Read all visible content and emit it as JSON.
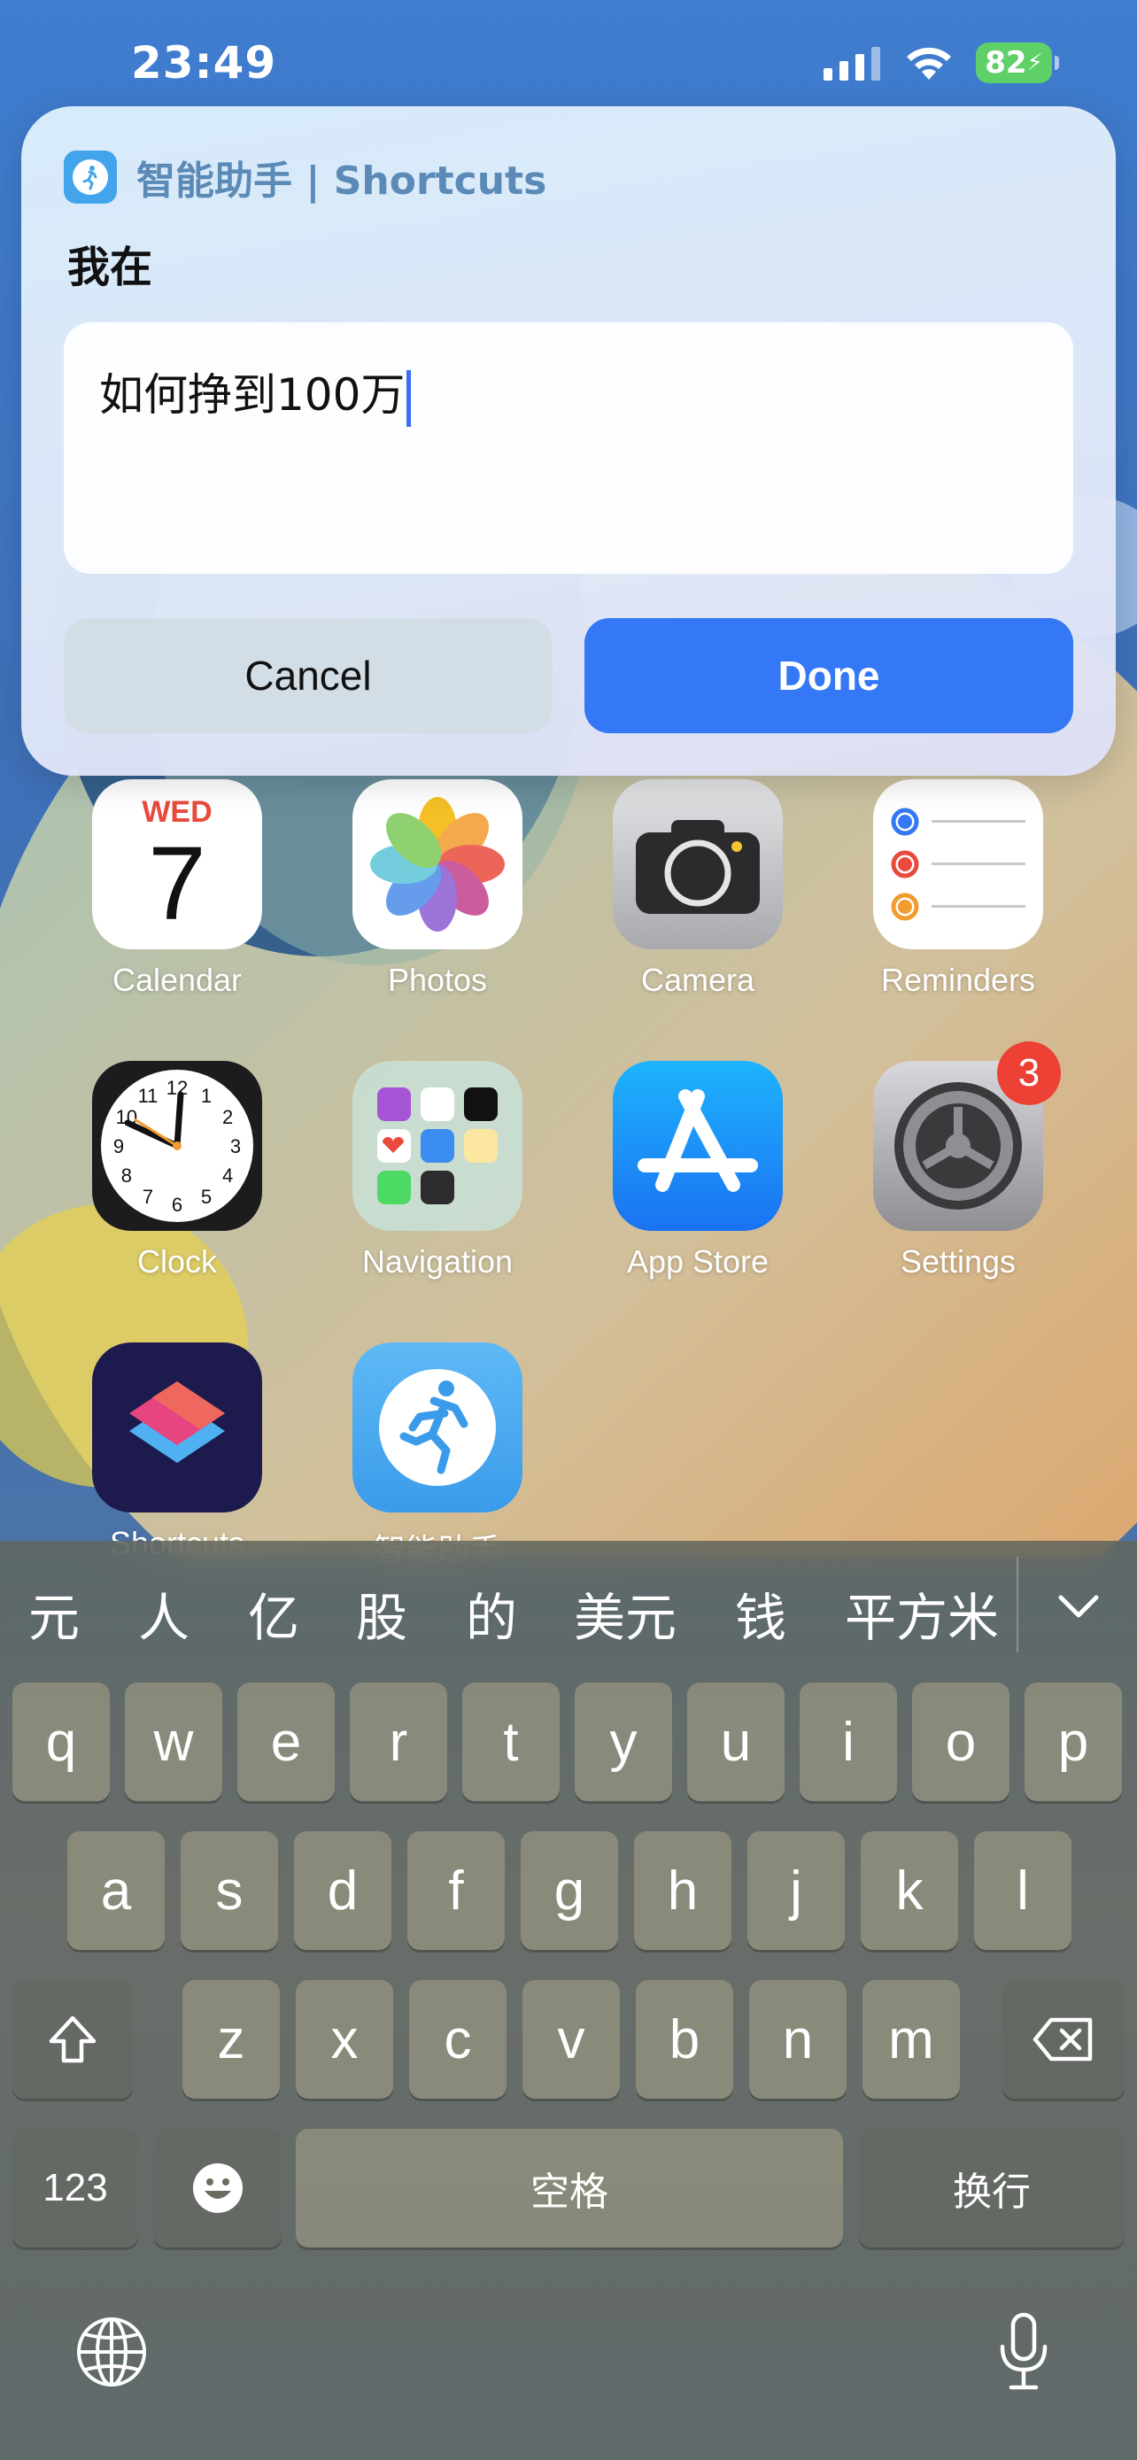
{
  "status_bar": {
    "time": "23:49",
    "battery": "82"
  },
  "dialog": {
    "app_name": "智能助手 | Shortcuts",
    "prompt": "我在",
    "input_value": "如何挣到100万",
    "cancel_label": "Cancel",
    "done_label": "Done"
  },
  "home_apps": [
    {
      "label": "Calendar",
      "icon": "calendar-icon",
      "day": "WED",
      "date": "7"
    },
    {
      "label": "Photos",
      "icon": "photos-icon"
    },
    {
      "label": "Camera",
      "icon": "camera-icon"
    },
    {
      "label": "Reminders",
      "icon": "reminders-icon"
    },
    {
      "label": "Clock",
      "icon": "clock-icon"
    },
    {
      "label": "Navigation",
      "icon": "folder-icon"
    },
    {
      "label": "App Store",
      "icon": "app-store-icon"
    },
    {
      "label": "Settings",
      "icon": "settings-icon",
      "badge": "3"
    },
    {
      "label": "Shortcuts",
      "icon": "shortcuts-icon"
    },
    {
      "label": "智能助手",
      "icon": "assistant-icon"
    }
  ],
  "clock_numbers": [
    "12",
    "1",
    "2",
    "3",
    "4",
    "5",
    "6",
    "7",
    "8",
    "9",
    "10",
    "11"
  ],
  "keyboard": {
    "candidates": [
      "元",
      "人",
      "亿",
      "股",
      "的",
      "美元",
      "钱",
      "平方米"
    ],
    "row1": [
      "q",
      "w",
      "e",
      "r",
      "t",
      "y",
      "u",
      "i",
      "o",
      "p"
    ],
    "row2": [
      "a",
      "s",
      "d",
      "f",
      "g",
      "h",
      "j",
      "k",
      "l"
    ],
    "row3": [
      "z",
      "x",
      "c",
      "v",
      "b",
      "n",
      "m"
    ],
    "numbers_key": "123",
    "space_key": "空格",
    "return_key": "换行"
  },
  "colors": {
    "accent": "#3478f6",
    "badge": "#ec4134",
    "battery": "#5fd068"
  }
}
